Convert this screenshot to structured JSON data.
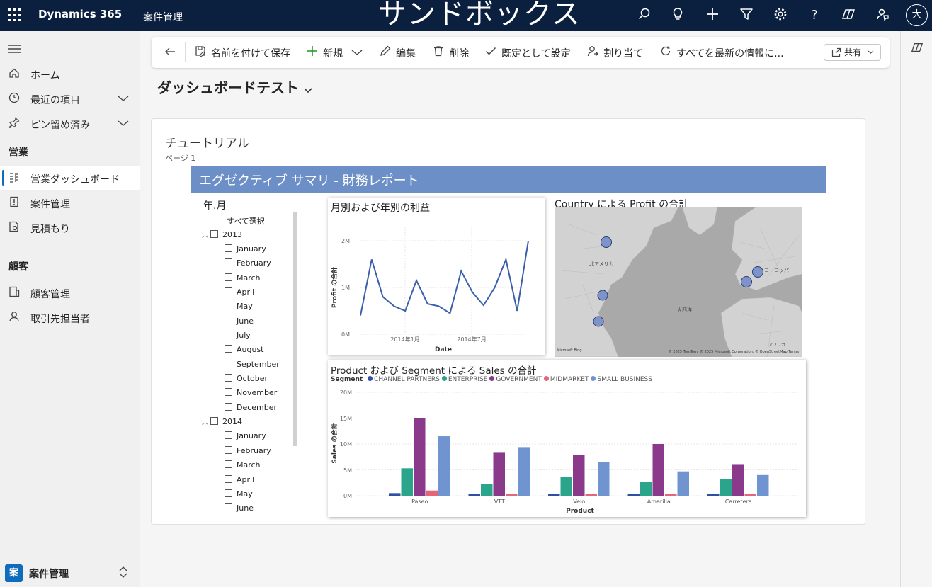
{
  "topbar": {
    "brand": "Dynamics 365",
    "app_name": "案件管理",
    "environment": "サンドボックス",
    "avatar": "大",
    "icons": [
      "search-icon",
      "lightbulb-icon",
      "plus-icon",
      "filter-icon",
      "settings-icon",
      "help-icon",
      "copilot-icon",
      "feedback-icon"
    ]
  },
  "sidebar": {
    "items": [
      {
        "label": "ホーム",
        "icon": "home-icon"
      },
      {
        "label": "最近の項目",
        "icon": "clock-icon"
      },
      {
        "label": "ピン留め済み",
        "icon": "pin-icon"
      }
    ],
    "groups": [
      {
        "label": "営業",
        "items": [
          {
            "label": "営業ダッシュボード",
            "icon": "dashboard-icon",
            "selected": true
          },
          {
            "label": "案件管理",
            "icon": "opportunity-icon"
          },
          {
            "label": "見積もり",
            "icon": "quote-icon"
          }
        ]
      },
      {
        "label": "顧客",
        "items": [
          {
            "label": "顧客管理",
            "icon": "account-icon"
          },
          {
            "label": "取引先担当者",
            "icon": "contact-icon"
          }
        ]
      }
    ],
    "area": {
      "badge": "案",
      "label": "案件管理"
    }
  },
  "commandbar": {
    "save_as": "名前を付けて保存",
    "new": "新規",
    "edit": "編集",
    "delete": "削除",
    "set_default": "既定として設定",
    "assign": "割り当て",
    "refresh": "すべてを最新の情報に...",
    "share": "共有"
  },
  "page": {
    "title": "ダッシュボードテスト"
  },
  "report": {
    "title": "チュートリアル",
    "page_label": "ページ 1",
    "header": "エグゼクティブ サマリ - 財務レポート"
  },
  "slicer": {
    "title": "年.月",
    "select_all": "すべて選択",
    "years": [
      {
        "year": "2013",
        "months": [
          "January",
          "February",
          "March",
          "April",
          "May",
          "June",
          "July",
          "August",
          "September",
          "October",
          "November",
          "December"
        ]
      },
      {
        "year": "2014",
        "months": [
          "January",
          "February",
          "March",
          "April",
          "May",
          "June"
        ]
      }
    ]
  },
  "line_chart": {
    "title": "月別および年別の利益",
    "ylabel": "Profit の合計",
    "xlabel": "Date",
    "yticks": [
      "0M",
      "1M",
      "2M"
    ],
    "xticks": [
      "2014年1月",
      "2014年7月"
    ]
  },
  "map": {
    "title": "Country による Profit の合計",
    "labels": {
      "na": "北アメリカ",
      "atlantic": "大西洋",
      "europe": "ヨーロッパ",
      "africa": "アフリカ"
    },
    "attribution": "© 2025 TomTom, © 2025 Microsoft Corporation, © OpenStreetMap  Terms",
    "logo": "Microsoft Bing"
  },
  "bar_chart": {
    "title": "Product および Segment による Sales の合計",
    "legend_title": "Segment",
    "ylabel": "Sales の合計",
    "xlabel": "Product",
    "yticks": [
      "0M",
      "5M",
      "10M",
      "15M",
      "20M"
    ]
  },
  "chart_data": [
    {
      "type": "line",
      "title": "月別および年別の利益",
      "xlabel": "Date",
      "ylabel": "Profit の合計",
      "x": [
        "2013-09",
        "2013-10",
        "2013-11",
        "2013-12",
        "2014-01",
        "2014-02",
        "2014-03",
        "2014-04",
        "2014-05",
        "2014-06",
        "2014-07",
        "2014-08",
        "2014-09",
        "2014-10",
        "2014-11",
        "2014-12"
      ],
      "series": [
        {
          "values": [
            0.4,
            1.6,
            0.8,
            0.6,
            0.5,
            1.15,
            0.65,
            0.6,
            0.45,
            1.35,
            0.9,
            0.62,
            1.0,
            1.6,
            0.5,
            2.0
          ]
        }
      ],
      "ylim": [
        0,
        2.4
      ],
      "color": "#3b5fad",
      "grid": true
    },
    {
      "type": "bar",
      "title": "Product および Segment による Sales の合計",
      "xlabel": "Product",
      "ylabel": "Sales の合計",
      "categories": [
        "Paseo",
        "VTT",
        "Velo",
        "Amarilla",
        "Carretera"
      ],
      "series": [
        {
          "name": "CHANNEL PARTNERS",
          "color": "#2f4fa2",
          "values": [
            0.5,
            0.3,
            0.3,
            0.3,
            0.3
          ]
        },
        {
          "name": "ENTERPRISE",
          "color": "#2aa58b",
          "values": [
            5.3,
            2.3,
            3.6,
            2.6,
            3.2
          ]
        },
        {
          "name": "GOVERNMENT",
          "color": "#8b3a8b",
          "values": [
            15,
            8.3,
            7.9,
            10,
            6.1
          ]
        },
        {
          "name": "MIDMARKET",
          "color": "#e3667a",
          "values": [
            1.0,
            0.4,
            0.4,
            0.4,
            0.4
          ]
        },
        {
          "name": "SMALL BUSINESS",
          "color": "#6f94d0",
          "values": [
            11.5,
            9.4,
            6.5,
            4.7,
            4.0
          ]
        }
      ],
      "ylim": [
        0,
        20
      ],
      "legend": "top-left",
      "grid": true
    }
  ]
}
